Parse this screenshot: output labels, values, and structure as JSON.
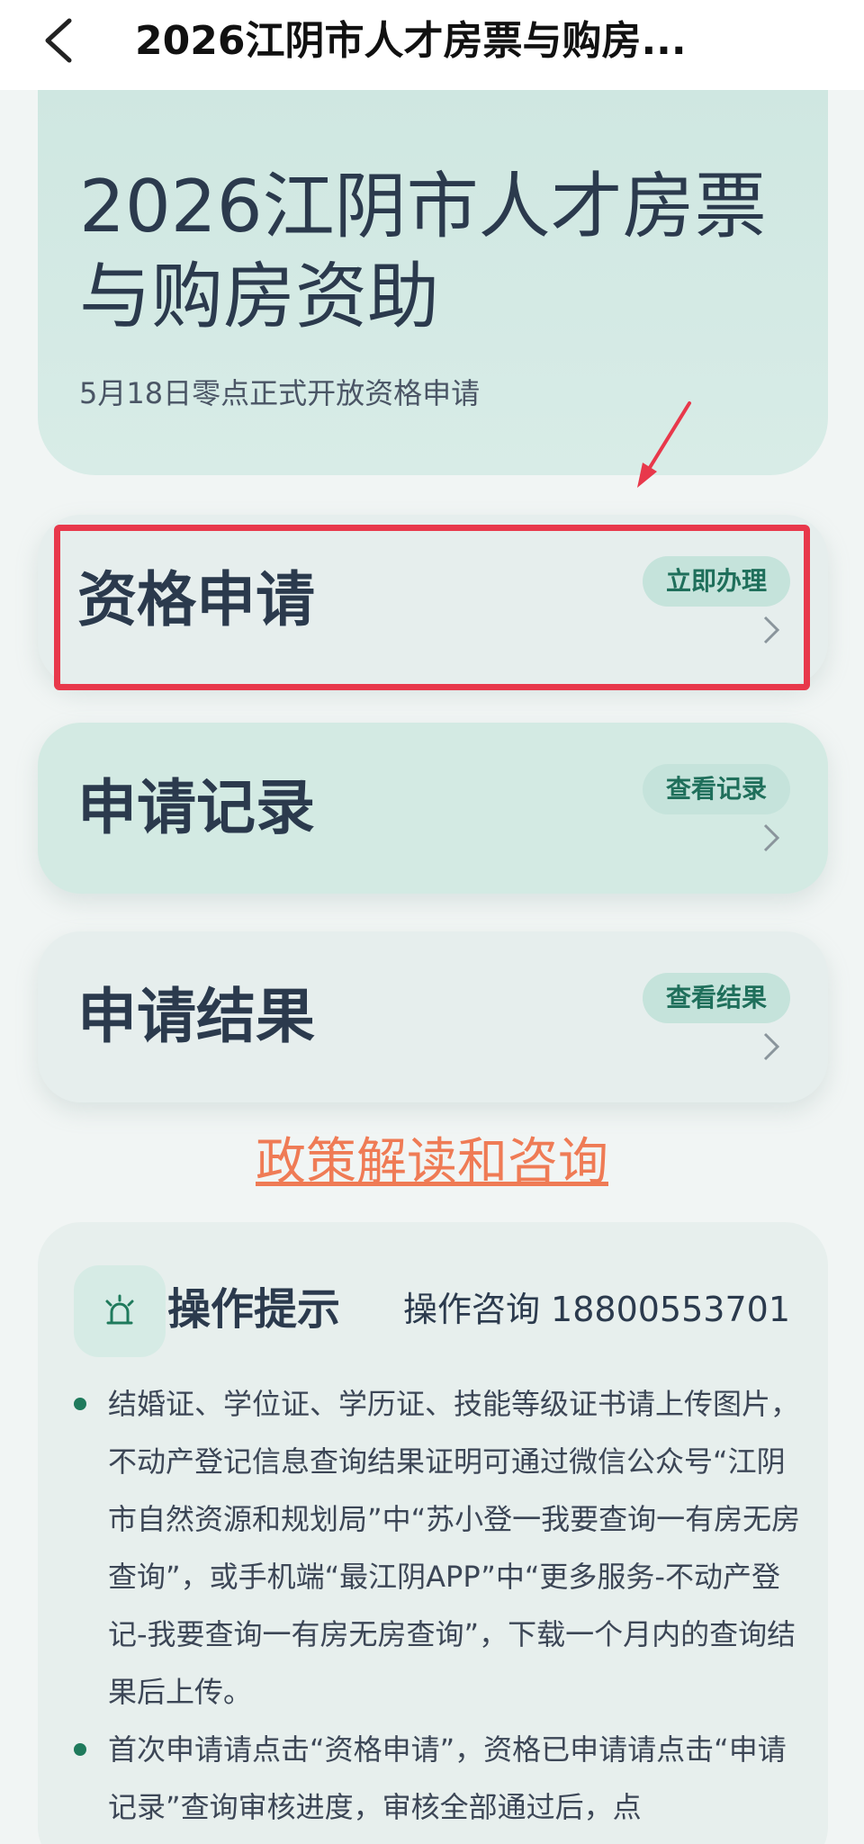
{
  "nav": {
    "title": "2026江阴市人才房票与购房..."
  },
  "banner": {
    "title": "2026江阴市人才房票与购房资助",
    "subtitle": "5月18日零点正式开放资格申请"
  },
  "cards": [
    {
      "title": "资格申请",
      "action": "立即办理"
    },
    {
      "title": "申请记录",
      "action": "查看记录"
    },
    {
      "title": "申请结果",
      "action": "查看结果"
    }
  ],
  "policy_link": "政策解读和咨询",
  "tips": {
    "title": "操作提示",
    "phone_label": "操作咨询 18800553701",
    "items": [
      "结婚证、学位证、学历证、技能等级证书请上传图片，不动产登记信息查询结果证明可通过微信公众号“江阴市自然资源和规划局”中“苏小登一我要查询一有房无房查询”，或手机端“最江阴APP”中“更多服务-不动产登记-我要查询一有房无房查询”，下载一个月内的查询结果后上传。",
      "首次申请请点击“资格申请”，资格已申请请点击“申请记录”查询审核进度，审核全部通过后，点"
    ]
  },
  "colors": {
    "accent": "#1f6f5b",
    "highlight": "#e8384b",
    "link": "#ef7b55"
  },
  "icons": {
    "back": "chevron-left-icon",
    "chevron": "chevron-right-icon",
    "tips": "alarm-light-icon"
  }
}
